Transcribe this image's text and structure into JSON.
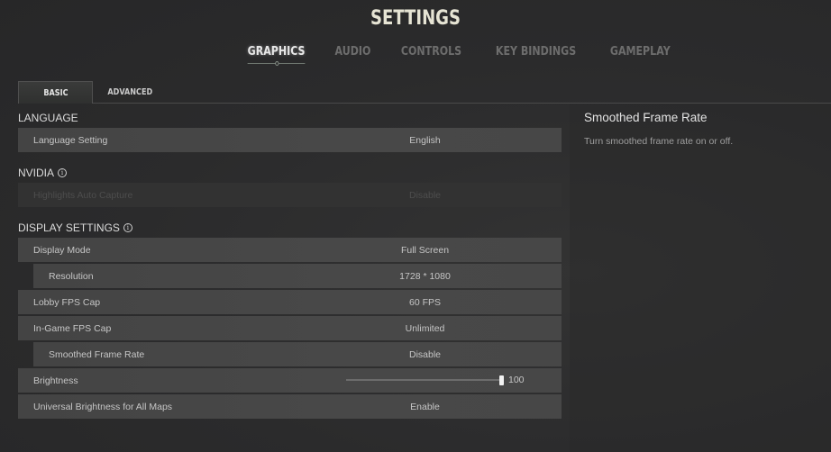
{
  "header": {
    "title": "SETTINGS"
  },
  "main_tabs": [
    {
      "label": "GRAPHICS",
      "active": true
    },
    {
      "label": "AUDIO",
      "active": false
    },
    {
      "label": "CONTROLS",
      "active": false
    },
    {
      "label": "KEY BINDINGS",
      "active": false
    },
    {
      "label": "GAMEPLAY",
      "active": false
    }
  ],
  "sub_tabs": [
    {
      "label": "BASIC",
      "active": true
    },
    {
      "label": "ADVANCED",
      "active": false
    }
  ],
  "sections": {
    "language": {
      "title": "LANGUAGE",
      "rows": [
        {
          "label": "Language Setting",
          "value": "English"
        }
      ]
    },
    "nvidia": {
      "title": "NVIDIA",
      "info_icon": "info-circle-icon",
      "rows": [
        {
          "label": "Highlights Auto Capture",
          "value": "Disable",
          "disabled": true
        }
      ]
    },
    "display": {
      "title": "DISPLAY SETTINGS",
      "info_icon": "info-circle-icon",
      "rows": [
        {
          "label": "Display Mode",
          "value": "Full Screen"
        },
        {
          "label": "Resolution",
          "value": "1728 * 1080",
          "indented": true
        },
        {
          "label": "Lobby FPS Cap",
          "value": "60 FPS"
        },
        {
          "label": "In-Game FPS Cap",
          "value": "Unlimited"
        },
        {
          "label": "Smoothed Frame Rate",
          "value": "Disable",
          "indented": true
        },
        {
          "label": "Brightness",
          "value": "100",
          "slider_fraction": 1.0
        },
        {
          "label": "Universal Brightness for All Maps",
          "value": "Enable"
        }
      ]
    }
  },
  "info_panel": {
    "title": "Smoothed Frame Rate",
    "description": "Turn smoothed frame rate on or off."
  }
}
